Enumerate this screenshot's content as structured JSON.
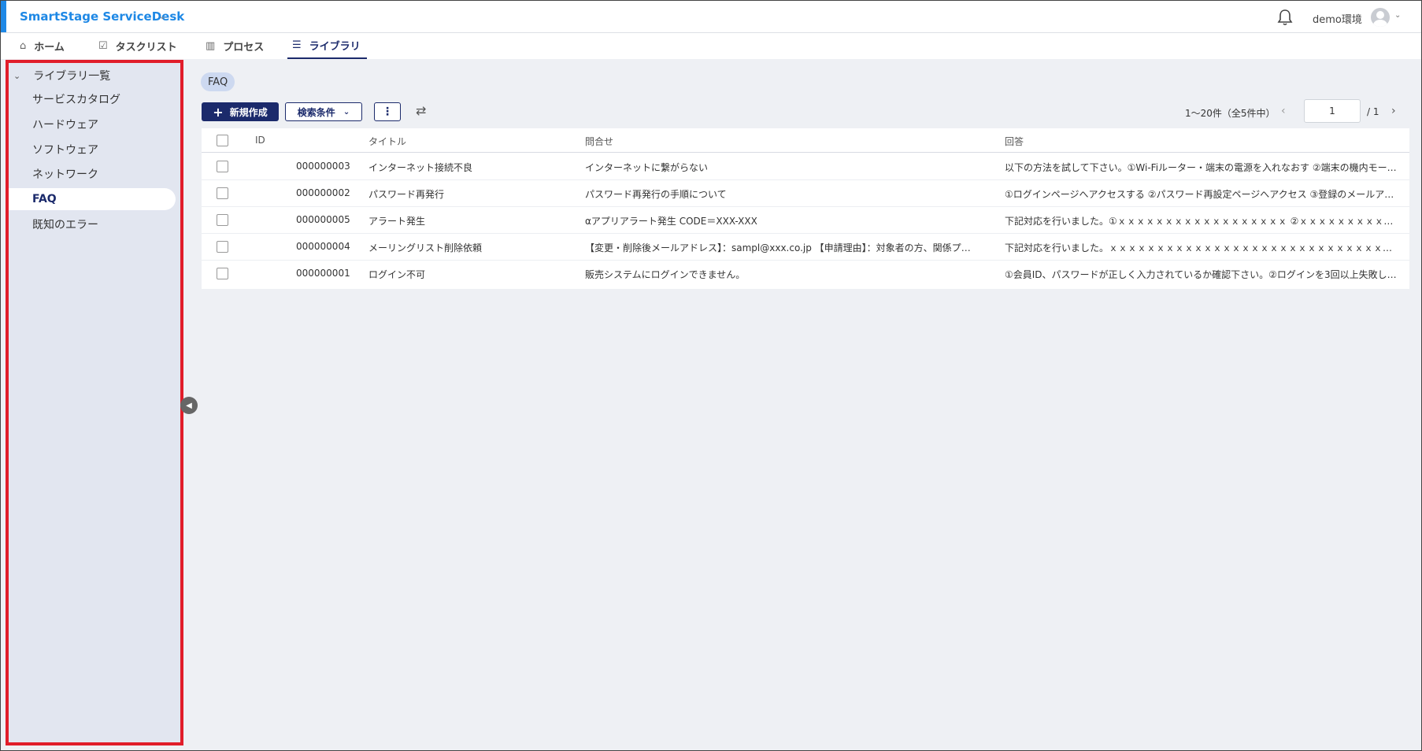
{
  "app": {
    "title": "SmartStage ServiceDesk",
    "env": "demo環境"
  },
  "nav": {
    "tabs": [
      {
        "label": "ホーム",
        "icon": "home-icon"
      },
      {
        "label": "タスクリスト",
        "icon": "checklist-icon"
      },
      {
        "label": "プロセス",
        "icon": "building-icon"
      },
      {
        "label": "ライブラリ",
        "icon": "list-icon",
        "active": true
      }
    ]
  },
  "sidebar": {
    "root": "ライブラリ一覧",
    "items": [
      {
        "label": "サービスカタログ"
      },
      {
        "label": "ハードウェア"
      },
      {
        "label": "ソフトウェア"
      },
      {
        "label": "ネットワーク"
      },
      {
        "label": "FAQ",
        "active": true
      },
      {
        "label": "既知のエラー"
      }
    ]
  },
  "main": {
    "chip": "FAQ",
    "toolbar": {
      "new_label": "新規作成",
      "search_label": "検索条件",
      "more_label": "⋮"
    },
    "pager": {
      "summary": "1〜20件（全5件中）",
      "page": "1",
      "total": "/ 1"
    },
    "table": {
      "headers": [
        "ID",
        "タイトル",
        "問合せ",
        "回答"
      ],
      "rows": [
        {
          "id": "000000003",
          "title": "インターネット接続不良",
          "inquiry": "インターネットに繋がらない",
          "answer": "以下の方法を試して下さい。①Wi-Fiルーター・端末の電源を入れなおす ②端末の機内モード…"
        },
        {
          "id": "000000002",
          "title": "パスワード再発行",
          "inquiry": "パスワード再発行の手順について",
          "answer": "①ログインページへアクセスする ②パスワード再設定ページへアクセス ③登録のメールア…"
        },
        {
          "id": "000000005",
          "title": "アラート発生",
          "inquiry": "αアプリアラート発生 CODE＝XXX-XXX",
          "answer": "下記対応を行いました。①ｘｘｘｘｘｘｘｘｘｘｘｘｘｘｘｘｘｘ ②ｘｘｘｘｘｘｘｘｘ…"
        },
        {
          "id": "000000004",
          "title": "メーリングリスト削除依頼",
          "inquiry": "【変更・削除後メールアドレス】：sampl@xxx.co.jp 【申請理由】：対象者の方、関係プロ…",
          "answer": "下記対応を行いました。ｘｘｘｘｘｘｘｘｘｘｘｘｘｘｘｘｘｘｘｘｘｘｘｘｘｘｘｘｘ…"
        },
        {
          "id": "000000001",
          "title": "ログイン不可",
          "inquiry": "販売システムにログインできません。",
          "answer": "①会員ID、パスワードが正しく入力されているか確認下さい。②ログインを3回以上失敗し…"
        }
      ]
    }
  },
  "colors": {
    "brand": "#1e88e5",
    "primary": "#1b2a6b",
    "highlight_border": "#e11d2a"
  }
}
